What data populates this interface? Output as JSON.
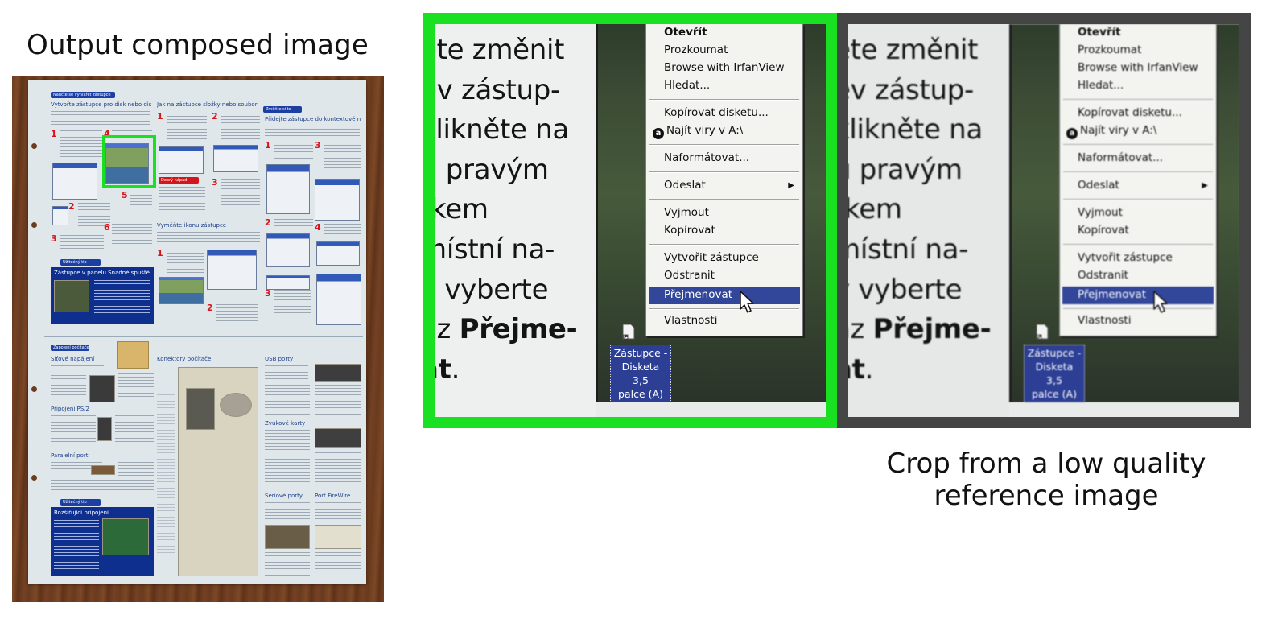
{
  "captions": {
    "output": "Output composed image",
    "reference": "Crop from a low quality reference image"
  },
  "colors": {
    "highlight": "#19e021",
    "reference_frame": "#454545",
    "menu_selection": "#32469a",
    "magazine_blue": "#1b3fa3",
    "step_number_red": "#d4161c"
  },
  "magazine": {
    "top_spread": {
      "tag": "Naučte se vytvářet zástupce",
      "col1_title": "Vytvořte zástupce pro disk nebo disketu",
      "col2_title": "Jak na zástupce složky nebo souboru",
      "col3_tag": "Změňte si to",
      "col3_title": "Přidejte zástupce do kontextové nabídky",
      "tip_box_title": "Zástupce v panelu Snadné spuštění",
      "tip_tag": "Užitečný tip",
      "good_idea": "Dobrý nápad",
      "icon_title": "Vyměňte ikonu zástupce"
    },
    "bottom_spread": {
      "tag": "Zapojení počítače",
      "power_title": "Síťové napájení",
      "connectors_title": "Konektory počítače",
      "usb_title": "USB porty",
      "ps2_title": "Připojení PS/2",
      "sound_title": "Zvukové karty",
      "parallel_title": "Paralelní port",
      "serial_title": "Sériové porty",
      "firewire_title": "Port FireWire",
      "tip_tag": "Užitečný tip",
      "tip_title": "Rozšiřující připojení"
    },
    "step_numbers": [
      "1",
      "2",
      "3",
      "4",
      "5",
      "6",
      "1",
      "2",
      "3",
      "1",
      "2",
      "3",
      "4",
      "1",
      "2",
      "3"
    ]
  },
  "crop": {
    "text_lines": [
      "ete změnit",
      "ev zástup-",
      "klikněte na",
      "u pravým",
      "tkem",
      "místní na-",
      "y vyberte",
      "az ",
      "at"
    ],
    "bold_word": "Přejme-",
    "trailing_period": ".",
    "context_menu": {
      "default_item": "Otevřít",
      "items_group1": [
        "Prozkoumat",
        "Browse with IrfanView",
        "Hledat..."
      ],
      "items_group2": [
        "Kopírovat disketu...",
        "Najít viry v A:\\"
      ],
      "av_icon_glyph": "a",
      "items_group3": [
        "Naformátovat..."
      ],
      "items_group4": [
        "Odeslat"
      ],
      "items_group5": [
        "Vyjmout",
        "Kopírovat"
      ],
      "items_group6": [
        "Vytvořit zástupce",
        "Odstranit"
      ],
      "selected_item": "Přejmenovat",
      "items_group7": [
        "Vlastnosti"
      ],
      "submenu_arrow": "▶"
    },
    "desktop_icon_label": [
      "Zástupce -",
      "Disketa 3,5",
      "palce (A)"
    ]
  }
}
